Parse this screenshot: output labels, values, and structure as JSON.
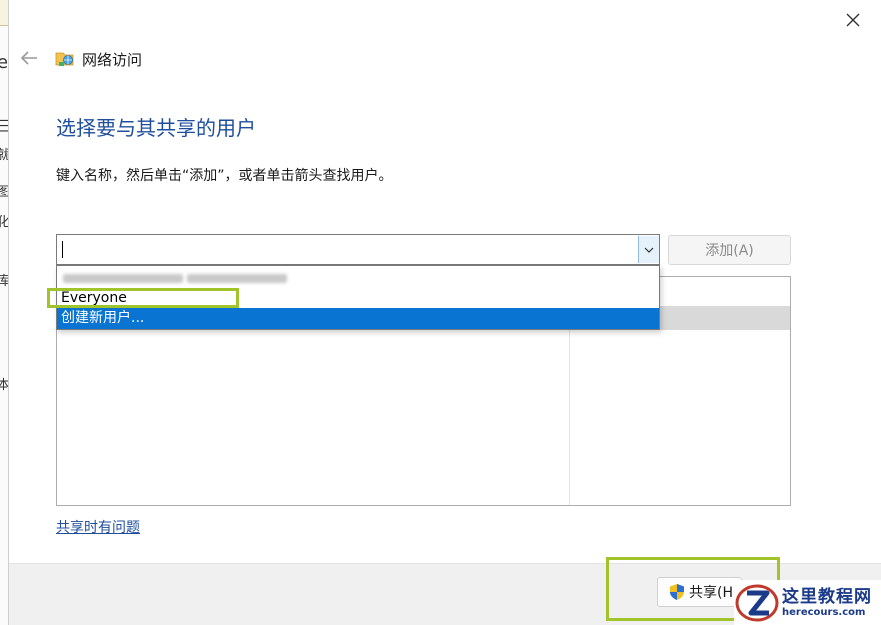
{
  "window": {
    "title": "网络访问"
  },
  "heading": "选择要与其共享的用户",
  "instruction": "键入名称，然后单击“添加”，或者单击箭头查找用户。",
  "name_input": {
    "value": "",
    "placeholder": ""
  },
  "add_button": "添加(A)",
  "dropdown": {
    "items": [
      "Everyone",
      "创建新用户..."
    ],
    "selected_index": 1
  },
  "help_link": "共享时有问题",
  "share_button": "共享(H)",
  "watermark": {
    "title": "这里教程网",
    "url": "herecours.com"
  },
  "colors": {
    "heading": "#1f4e9c",
    "selection": "#0a74d2",
    "highlight_box": "#a1c42b"
  },
  "background_fragments": [
    "e",
    "三",
    "就",
    "图",
    "化",
    "库",
    "本"
  ]
}
